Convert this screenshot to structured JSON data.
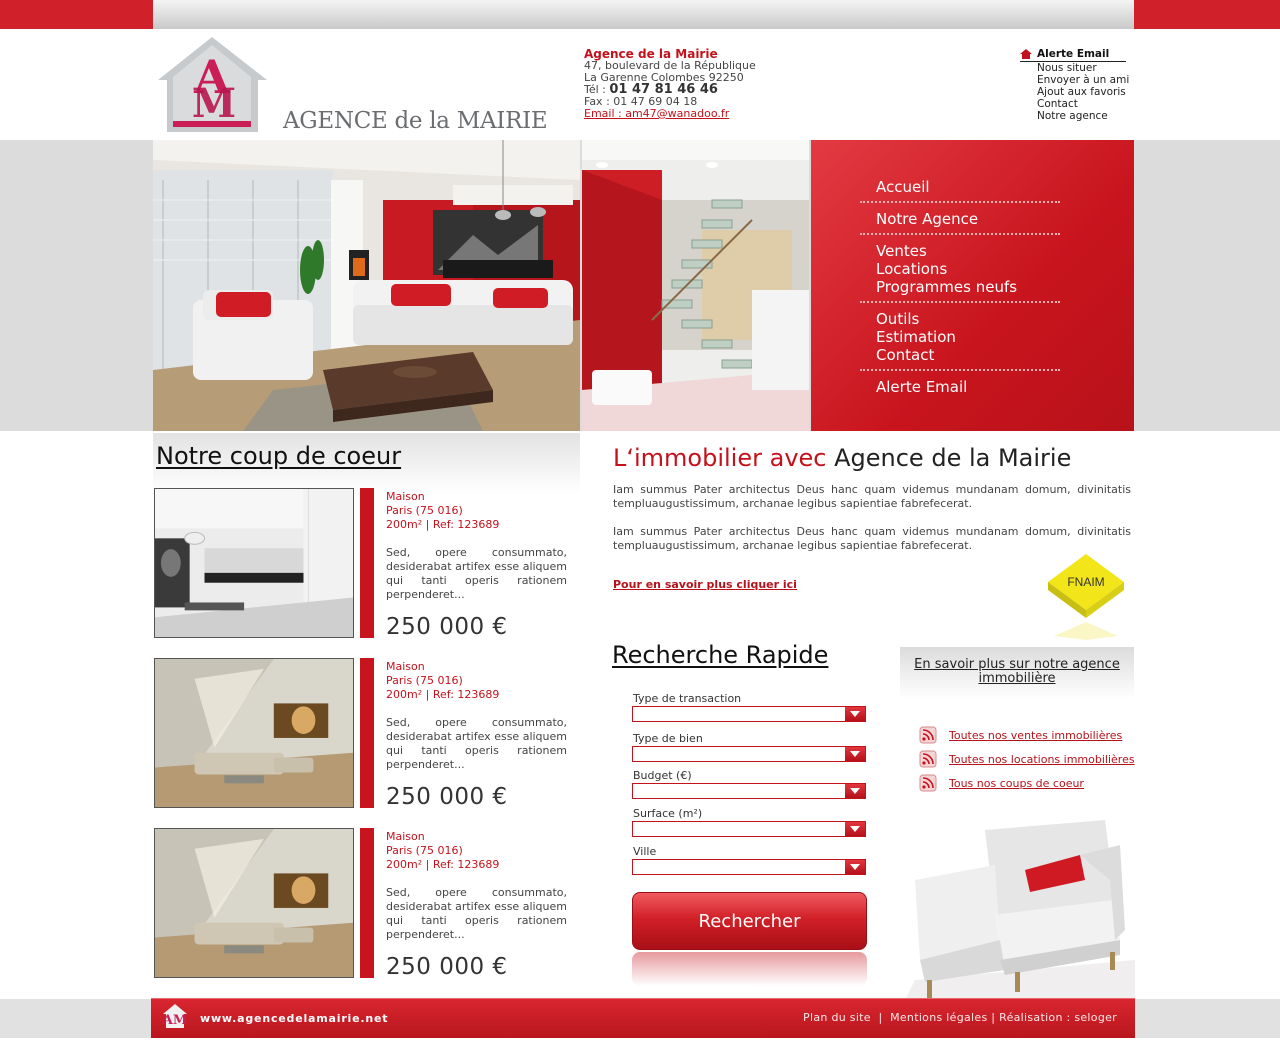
{
  "colors": {
    "brand_red": "#c8141d",
    "nav_bg": "#d0202a",
    "text": "#333333"
  },
  "logo": {
    "monogram": "AM",
    "name": "AGENCE de la MAIRIE"
  },
  "contact": {
    "name": "Agence de la Mairie",
    "street": "47, boulevard de la République",
    "city": "La Garenne Colombes 92250",
    "tel_label": "Tél : ",
    "tel": "01 47 81 46 46",
    "fax": "Fax : 01 47 69 04 18",
    "email": "Email : am47@wanadoo.fr"
  },
  "toplinks": {
    "alert": "Alerte Email",
    "items": [
      "Nous situer",
      "Envoyer à un ami",
      "Ajout aux favoris",
      "Contact",
      "Notre agence"
    ]
  },
  "nav": {
    "accueil": "Accueil",
    "agence": "Notre Agence",
    "ventes": "Ventes",
    "locations": "Locations",
    "programmes": "Programmes neufs",
    "outils": "Outils",
    "estimation": "Estimation",
    "contact": "Contact",
    "alerte": "Alerte Email"
  },
  "coup_de_coeur": {
    "title": "Notre coup de coeur",
    "listings": [
      {
        "type": "Maison",
        "location": "Paris (75 016)",
        "ref": "200m² | Ref: 123689",
        "desc": "Sed, opere consummato, desiderabat artifex esse aliquem qui tanti operis rationem perpenderet...",
        "price": "250 000 €"
      },
      {
        "type": "Maison",
        "location": "Paris (75 016)",
        "ref": "200m² | Ref: 123689",
        "desc": "Sed, opere consummato, desiderabat artifex esse aliquem qui tanti operis rationem perpenderet...",
        "price": "250 000 €"
      },
      {
        "type": "Maison",
        "location": "Paris (75 016)",
        "ref": "200m² | Ref: 123689",
        "desc": "Sed, opere consummato, desiderabat artifex esse aliquem qui tanti operis rationem perpenderet...",
        "price": "250 000 €"
      }
    ]
  },
  "intro": {
    "title_red": "L‘immobilier avec ",
    "title_dark": "Agence de la Mairie",
    "p1": "Iam summus Pater architectus Deus hanc quam videmus mundanam domum, divinitatis templuaugustissimum, archanae legibus sapientiae fabrefecerat.",
    "p2": "Iam summus Pater architectus Deus hanc quam videmus mundanam domum, divinitatis templuaugustissimum, archanae legibus sapientiae fabrefecerat.",
    "more": "Pour en savoir plus cliquer ici",
    "badge": "FNAIM"
  },
  "search": {
    "title": "Recherche Rapide",
    "fields": [
      {
        "label": "Type de transaction",
        "value": ""
      },
      {
        "label": "Type de bien",
        "value": ""
      },
      {
        "label": "Budget (€)",
        "value": ""
      },
      {
        "label": "Surface (m²)",
        "value": ""
      },
      {
        "label": "Ville",
        "value": ""
      }
    ],
    "button": "Rechercher"
  },
  "sidebar": {
    "info_link": "En savoir plus sur notre agence immobilière",
    "rss": [
      "Toutes nos ventes immobilières",
      "Toutes nos locations immobilières",
      "Tous nos coups de coeur"
    ]
  },
  "footer": {
    "site": "www.agencedelamairie.net",
    "plan": "Plan du site",
    "sep1": "  |  ",
    "mentions": "Mentions légales",
    "sep2": " | ",
    "realisation": "Réalisation : seloger"
  }
}
